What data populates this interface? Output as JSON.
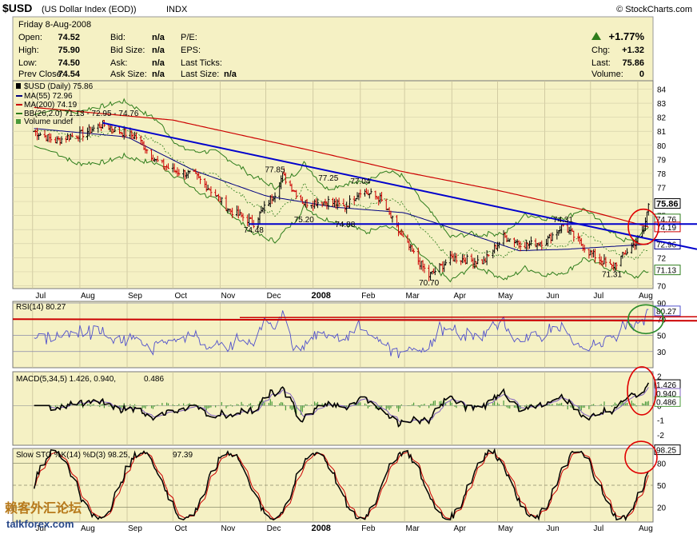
{
  "header": {
    "symbol": "$USD",
    "name": "(US Dollar Index (EOD))",
    "exchange": "INDX",
    "brand": "© StockCharts.com"
  },
  "quote": {
    "date": "Friday   8-Aug-2008",
    "open_label": "Open:",
    "open": "74.52",
    "high_label": "High:",
    "high": "75.90",
    "low_label": "Low:",
    "low": "74.50",
    "prev_close_label": "Prev Close:",
    "prev_close": "74.54",
    "bid_label": "Bid:",
    "bid": "n/a",
    "bid_size_label": "Bid Size:",
    "bid_size": "n/a",
    "ask_label": "Ask:",
    "ask": "n/a",
    "ask_size_label": "Ask Size:",
    "ask_size": "n/a",
    "pe_label": "P/E:",
    "eps_label": "EPS:",
    "last_ticks_label": "Last Ticks:",
    "last_size_label": "Last Size:",
    "last_size": "n/a",
    "change_pct": "+1.77%",
    "chg_label": "Chg:",
    "chg": "+1.32",
    "last_label": "Last:",
    "last": "75.86",
    "volume_label": "Volume:",
    "volume": "0"
  },
  "legend": {
    "price": "$USD (Daily) 75.86",
    "ma55": "MA(55) 72.96",
    "ma200": "MA(200) 74.19",
    "bb": "BB(26,2.0) 71.13 - 72.95 - 74.76",
    "volume": "Volume undef"
  },
  "price_axis": [
    "84",
    "83",
    "82",
    "81",
    "80",
    "79",
    "78",
    "77",
    "76",
    "75",
    "74",
    "73",
    "72",
    "71",
    "70"
  ],
  "value_tags": {
    "last": "75.86",
    "bb_upper": "74.76",
    "ma200": "74.19",
    "ma55": "72.96",
    "bb_lower": "71.13"
  },
  "annotations": [
    {
      "text": "77.85",
      "date": "2007-12-07",
      "value": 77.85
    },
    {
      "text": "77.25",
      "date": "2008-01-11",
      "value": 77.25
    },
    {
      "text": "77.04",
      "date": "2008-02-01",
      "value": 77.04
    },
    {
      "text": "75.20",
      "date": "2007-12-26",
      "value": 75.2
    },
    {
      "text": "74.88",
      "date": "2008-01-22",
      "value": 74.88
    },
    {
      "text": "74.48",
      "date": "2007-11-23",
      "value": 74.48
    },
    {
      "text": "74.31",
      "date": "2008-06-13",
      "value": 74.31
    },
    {
      "text": "70.70",
      "date": "2008-03-17",
      "value": 70.7
    },
    {
      "text": "71.31",
      "date": "2008-07-15",
      "value": 71.31
    }
  ],
  "months_top": [
    "Jul",
    "Aug",
    "Sep",
    "Oct",
    "Nov",
    "Dec",
    "2008",
    "Feb",
    "Mar",
    "Apr",
    "May",
    "Jun",
    "Jul",
    "Aug"
  ],
  "rsi": {
    "label": "RSI(14) 80.27",
    "value": "80.27",
    "axis": [
      "90",
      "70",
      "50",
      "30"
    ]
  },
  "macd": {
    "label_main": "MACD(5,34,5) 1.426, 0.940,",
    "label_hist": "0.486",
    "values": [
      "1.426",
      "0.940",
      "0.486"
    ],
    "axis": [
      "2",
      "1",
      "0",
      "-1",
      "-2"
    ]
  },
  "sto": {
    "label_main": "Slow STO %K(14) %D(3) 98.25,",
    "label_d": "97.39",
    "value": "98.25",
    "axis": [
      "80",
      "50",
      "20"
    ]
  },
  "months_bottom": [
    "Jul",
    "Aug",
    "Sep",
    "Oct",
    "Nov",
    "Dec",
    "2008",
    "Feb",
    "Mar",
    "Apr",
    "May",
    "Jun",
    "Jul",
    "Aug"
  ],
  "watermark": {
    "cn": "赖客外汇论坛",
    "en": "talkforex.com"
  },
  "colors": {
    "panel_bg": "#f5f1c4",
    "price_up": "#000000",
    "price_down": "#cc0000",
    "ma55": "#000080",
    "ma200": "#cc0000",
    "bb": "#2e7d1b",
    "trendline": "#0000cc",
    "rsi_line": "#5050cc",
    "macd_line": "#000000",
    "macd_signal": "#8060c0",
    "macd_hist": "#4a9a3a",
    "sto_k": "#000000",
    "sto_d": "#cc0000",
    "circle_red": "#e00000",
    "circle_green": "#2a8a2a"
  },
  "chart_data": [
    {
      "type": "line",
      "title": "$USD (US Dollar Index (EOD))",
      "series": [
        {
          "name": "$USD (Daily)",
          "points": [
            [
              "2007-07-02",
              81.0
            ],
            [
              "2007-07-16",
              80.3
            ],
            [
              "2007-07-24",
              80.6
            ],
            [
              "2007-08-02",
              80.8
            ],
            [
              "2007-08-16",
              81.5
            ],
            [
              "2007-08-27",
              81.0
            ],
            [
              "2007-09-07",
              80.6
            ],
            [
              "2007-09-20",
              78.9
            ],
            [
              "2007-10-01",
              78.2
            ],
            [
              "2007-10-15",
              77.9
            ],
            [
              "2007-10-26",
              76.8
            ],
            [
              "2007-11-07",
              75.4
            ],
            [
              "2007-11-23",
              74.48
            ],
            [
              "2007-12-07",
              76.6
            ],
            [
              "2007-12-12",
              77.85
            ],
            [
              "2007-12-26",
              75.9
            ],
            [
              "2008-01-11",
              76.0
            ],
            [
              "2008-01-22",
              75.6
            ],
            [
              "2008-02-01",
              76.8
            ],
            [
              "2008-02-14",
              76.2
            ],
            [
              "2008-02-28",
              73.5
            ],
            [
              "2008-03-17",
              70.7
            ],
            [
              "2008-04-01",
              72.0
            ],
            [
              "2008-04-22",
              71.7
            ],
            [
              "2008-05-05",
              73.5
            ],
            [
              "2008-05-20",
              72.9
            ],
            [
              "2008-06-02",
              73.2
            ],
            [
              "2008-06-13",
              74.31
            ],
            [
              "2008-06-30",
              72.4
            ],
            [
              "2008-07-15",
              71.31
            ],
            [
              "2008-07-28",
              72.8
            ],
            [
              "2008-08-05",
              73.9
            ],
            [
              "2008-08-08",
              75.86
            ]
          ]
        },
        {
          "name": "MA(55)",
          "points": [
            [
              "2007-07-02",
              81.2
            ],
            [
              "2007-09-01",
              80.6
            ],
            [
              "2007-10-15",
              78.2
            ],
            [
              "2007-12-01",
              76.4
            ],
            [
              "2008-01-15",
              75.6
            ],
            [
              "2008-03-01",
              75.2
            ],
            [
              "2008-04-15",
              73.6
            ],
            [
              "2008-05-15",
              72.5
            ],
            [
              "2008-06-15",
              72.6
            ],
            [
              "2008-07-15",
              72.8
            ],
            [
              "2008-08-08",
              72.96
            ]
          ]
        },
        {
          "name": "MA(200)",
          "points": [
            [
              "2007-07-02",
              82.7
            ],
            [
              "2007-10-01",
              81.8
            ],
            [
              "2008-01-01",
              79.6
            ],
            [
              "2008-03-01",
              78.1
            ],
            [
              "2008-05-01",
              76.8
            ],
            [
              "2008-07-01",
              75.3
            ],
            [
              "2008-08-08",
              74.19
            ]
          ]
        }
      ],
      "ylim": [
        70,
        84
      ]
    },
    {
      "type": "line",
      "title": "RSI(14)",
      "series": [
        {
          "name": "RSI(14)",
          "last": 80.27
        }
      ],
      "ylim": [
        10,
        90
      ]
    },
    {
      "type": "line",
      "title": "MACD(5,34,5)",
      "series": [
        {
          "name": "MACD",
          "last": 1.426
        },
        {
          "name": "Signal",
          "last": 0.94
        },
        {
          "name": "Histogram",
          "last": 0.486
        }
      ],
      "ylim": [
        -2.6,
        2.2
      ]
    },
    {
      "type": "line",
      "title": "Slow STO %K(14) %D(3)",
      "series": [
        {
          "name": "%K",
          "last": 98.25
        },
        {
          "name": "%D",
          "last": 97.39
        }
      ],
      "ylim": [
        0,
        100
      ]
    }
  ]
}
